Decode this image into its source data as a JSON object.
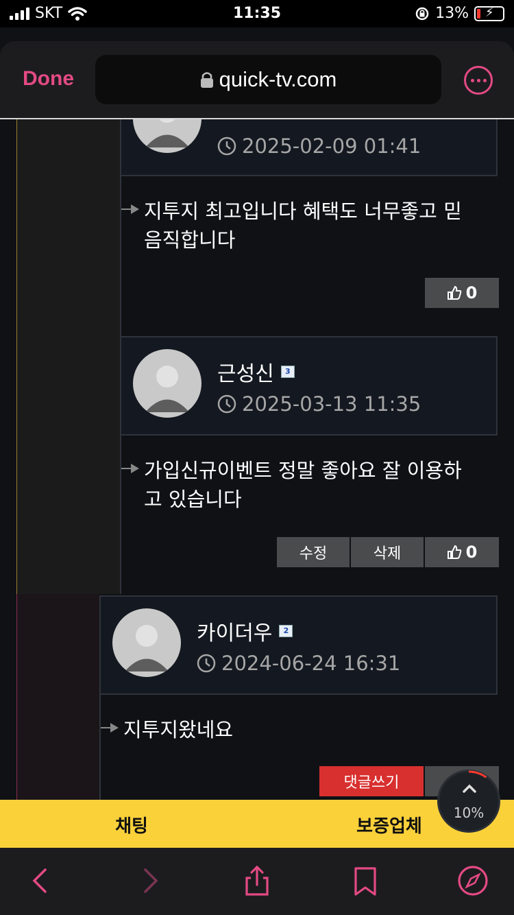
{
  "status": {
    "carrier": "SKT",
    "time": "11:35",
    "battery": "13%",
    "battery_level": 0.13,
    "battery_color": "#ff3b30"
  },
  "browser": {
    "done_label": "Done",
    "url": "quick-tv.com",
    "accent_color": "#e44a84"
  },
  "comments": [
    {
      "author": "",
      "datetime": "2025-02-09 01:41",
      "text_line1": "지투지 최고입니다 혜택도 너무좋고 믿",
      "text_line2": "음직합니다",
      "likes": "0"
    },
    {
      "author": "근성신",
      "level": "3",
      "datetime": "2025-03-13 11:35",
      "text_line1": "가입신규이벤트 정말 좋아요 잘 이용하",
      "text_line2": "고 있습니다",
      "edit_label": "수정",
      "delete_label": "삭제",
      "likes": "0"
    },
    {
      "author": "카이더우",
      "level": "2",
      "datetime": "2024-06-24 16:31",
      "text_line1": "지투지왔네요",
      "reply_label": "댓글쓰기"
    }
  ],
  "banner": {
    "left_label": "채팅",
    "right_label": "보증업체",
    "color": "#fbd13a"
  },
  "scroll_progress": {
    "label": "10%",
    "value": 0.1
  },
  "icons": [
    "signal-icon",
    "wifi-icon",
    "rotation-lock-icon",
    "battery-icon",
    "lock-icon",
    "more-icon",
    "clock-icon",
    "thumbs-up-icon",
    "chevron-up-icon",
    "back-icon",
    "forward-icon",
    "share-icon",
    "bookmark-icon",
    "compass-icon"
  ]
}
